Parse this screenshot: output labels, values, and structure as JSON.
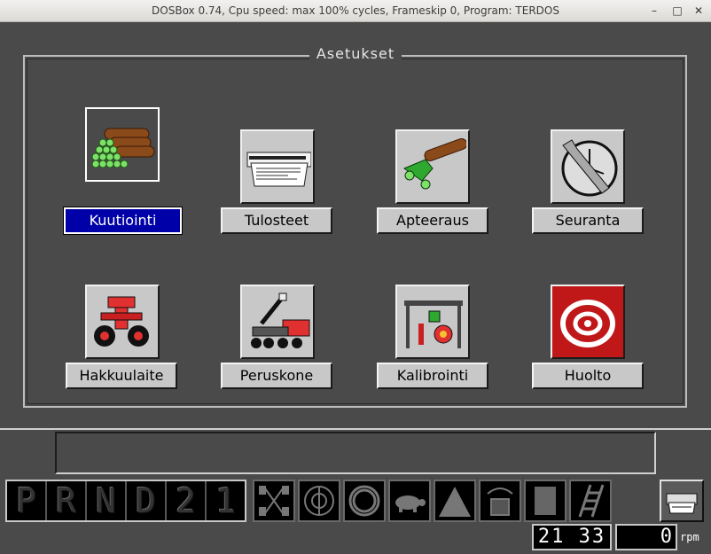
{
  "window": {
    "title": "DOSBox 0.74, Cpu speed: max 100% cycles, Frameskip  0, Program:   TERDOS",
    "minimize_glyph": "–",
    "maximize_glyph": "□",
    "close_glyph": "✕"
  },
  "panel": {
    "title": "Asetukset"
  },
  "menu": [
    {
      "label": "Kuutiointi",
      "icon": "log-pile-icon",
      "selected": true
    },
    {
      "label": "Tulosteet",
      "icon": "printout-icon",
      "selected": false
    },
    {
      "label": "Apteeraus",
      "icon": "bucking-icon",
      "selected": false
    },
    {
      "label": "Seuranta",
      "icon": "clock-wrench-icon",
      "selected": false
    },
    {
      "label": "Hakkuulaite",
      "icon": "harvester-head-icon",
      "selected": false
    },
    {
      "label": "Peruskone",
      "icon": "base-machine-icon",
      "selected": false
    },
    {
      "label": "Kalibrointi",
      "icon": "calibration-icon",
      "selected": false
    },
    {
      "label": "Huolto",
      "icon": "service-icon",
      "selected": false
    }
  ],
  "gears": [
    "P",
    "R",
    "N",
    "D",
    "2",
    "1"
  ],
  "toolbar": [
    "axle-icon",
    "steering-icon",
    "circle-icon",
    "turtle-icon",
    "road-icon",
    "cabin-rotate-icon",
    "cabin-icon",
    "ladder-icon"
  ],
  "clock": "21 33",
  "rpm_value": "0",
  "rpm_unit": "rpm",
  "colors": {
    "background": "#4a4a4a",
    "selected_label": "#0000a8",
    "button_face": "#c8c8c8"
  }
}
